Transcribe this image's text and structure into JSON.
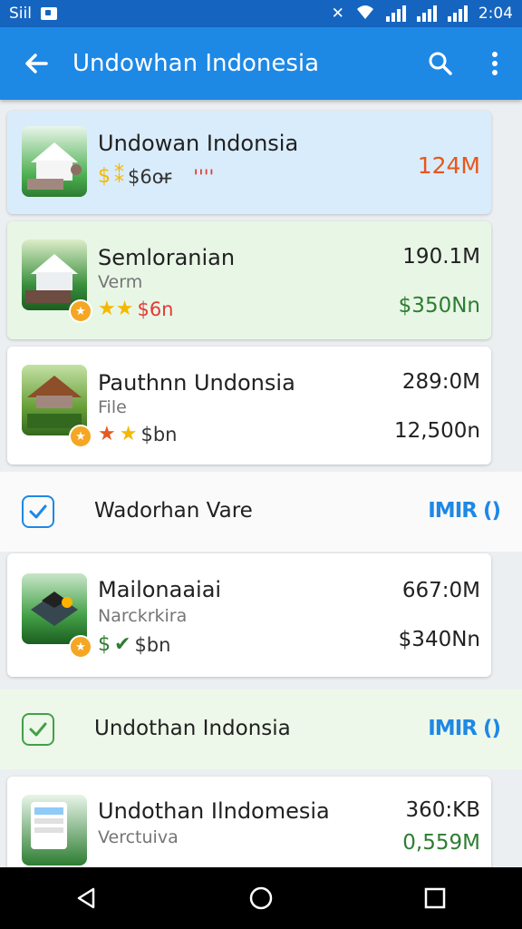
{
  "status_bar": {
    "left_text": "Siil",
    "time": "2:04"
  },
  "app_bar": {
    "title": "Undowhan Indonesia",
    "back_icon": "arrow-back-icon",
    "search_icon": "search-icon",
    "menu_icon": "overflow-menu-icon"
  },
  "items": [
    {
      "name": "Undowan Indonsia",
      "meta": "$6or̶",
      "extra": "''''",
      "size": "124M",
      "price": ""
    },
    {
      "name": "Semloranian",
      "sub": "Verm",
      "meta": "$6n",
      "size": "190.1M",
      "price": "$350Nn"
    },
    {
      "name": "Pauthnn Undonsia",
      "sub": "File",
      "meta": "$bn",
      "size": "289:0M",
      "price": "12,500n"
    },
    {
      "name": "Mailonaaiai",
      "sub": "Narckrkira",
      "meta": "$bn",
      "size": "667:0M",
      "price": "$340Nn"
    },
    {
      "name": "Undothan Ilndomesia",
      "sub": "Verctuiva",
      "meta": "",
      "size": "360:KB",
      "price": "0,559M"
    }
  ],
  "rows": [
    {
      "label": "Wadorhan Vare",
      "tag": "IMIR ()"
    },
    {
      "label": "Undothan Indonsia",
      "tag": "IMIR ()"
    }
  ],
  "colors": {
    "primary": "#1e88e5",
    "status_bar": "#1565c0",
    "accent_orange": "#e8571a",
    "price_green": "#2e7d32"
  }
}
